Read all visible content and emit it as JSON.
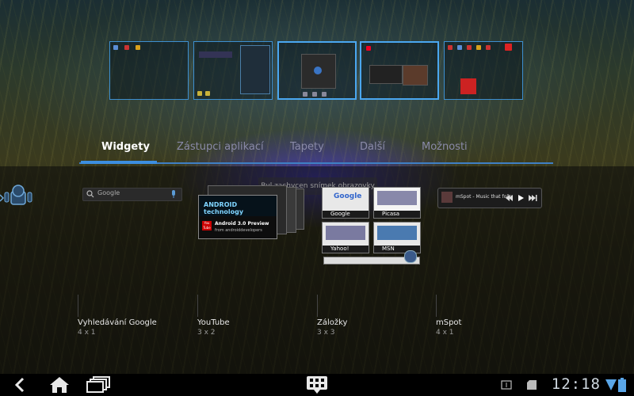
{
  "tabs": [
    {
      "label": "Widgety",
      "active": true
    },
    {
      "label": "Zástupci aplikací"
    },
    {
      "label": "Tapety"
    },
    {
      "label": "Další"
    },
    {
      "label": "Možnosti"
    }
  ],
  "toast": "Byl zachycen snímek obrazovky",
  "widgets": [
    {
      "name": "Vyhledávání Google",
      "size": "4 x 1"
    },
    {
      "name": "YouTube",
      "size": "3 x 2"
    },
    {
      "name": "Záložky",
      "size": "3 x 3"
    },
    {
      "name": "mSpot",
      "size": "4 x 1"
    }
  ],
  "search_widget": {
    "placeholder": "Google"
  },
  "youtube": {
    "banner": "ANDROID technology",
    "title": "Android 3.0 Preview",
    "source": "from androiddevelopers",
    "logo": "You Tube"
  },
  "bookmarks": [
    "Google",
    "Picasa",
    "Yahoo!",
    "MSN"
  ],
  "mspot": {
    "text": "mSpot - Music that follo"
  },
  "status": {
    "time": "12:18"
  },
  "colors": {
    "accent": "#3c8ee0",
    "tab_inactive": "#8a8aa8"
  }
}
